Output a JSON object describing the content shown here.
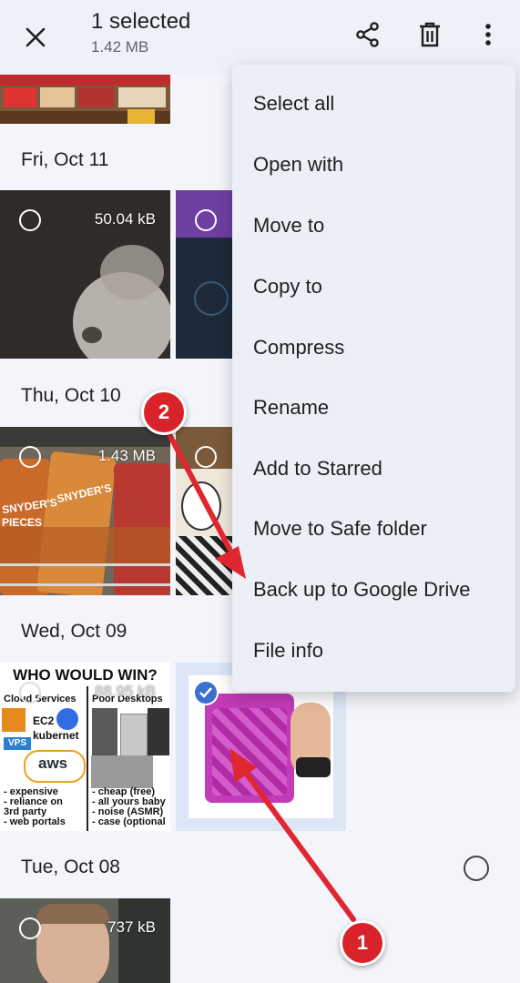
{
  "header": {
    "title": "1 selected",
    "subtitle": "1.42 MB"
  },
  "sections": {
    "fri": "Fri, Oct 11",
    "thu": "Thu, Oct 10",
    "wed": "Wed, Oct 09",
    "tue": "Tue, Oct 08"
  },
  "thumbs": {
    "cat_size": "50.04 kB",
    "snacks_size": "1.43 MB",
    "meme_size": "88.95 kB",
    "man_size": "737 kB"
  },
  "meme": {
    "title": "WHO WOULD WIN?",
    "left_head": "Cloud Services",
    "right_head": "Poor Desktops",
    "ec2": "EC2",
    "kube": "kubernet",
    "vps": "VPS",
    "aws": "aws",
    "left_list": [
      "- expensive",
      "- reliance on",
      "  3rd party",
      "- web portals"
    ],
    "right_list": [
      "- cheap (free)",
      "- all yours baby",
      "- noise (ASMR)",
      "- case (optional"
    ]
  },
  "snacks": {
    "brand1": "SNYDER'S",
    "brand2": "SNYDER'S",
    "brand3": "PIECES"
  },
  "menu": {
    "items": [
      "Select all",
      "Open with",
      "Move to",
      "Copy to",
      "Compress",
      "Rename",
      "Add to Starred",
      "Move to Safe folder",
      "Back up to Google Drive",
      "File info"
    ]
  },
  "annotations": {
    "badge1": "1",
    "badge2": "2"
  },
  "colors": {
    "accent": "#d9232a",
    "check": "#3b6fd0"
  },
  "icons": [
    "close-icon",
    "share-icon",
    "delete-icon",
    "more-vert-icon",
    "check-icon"
  ]
}
